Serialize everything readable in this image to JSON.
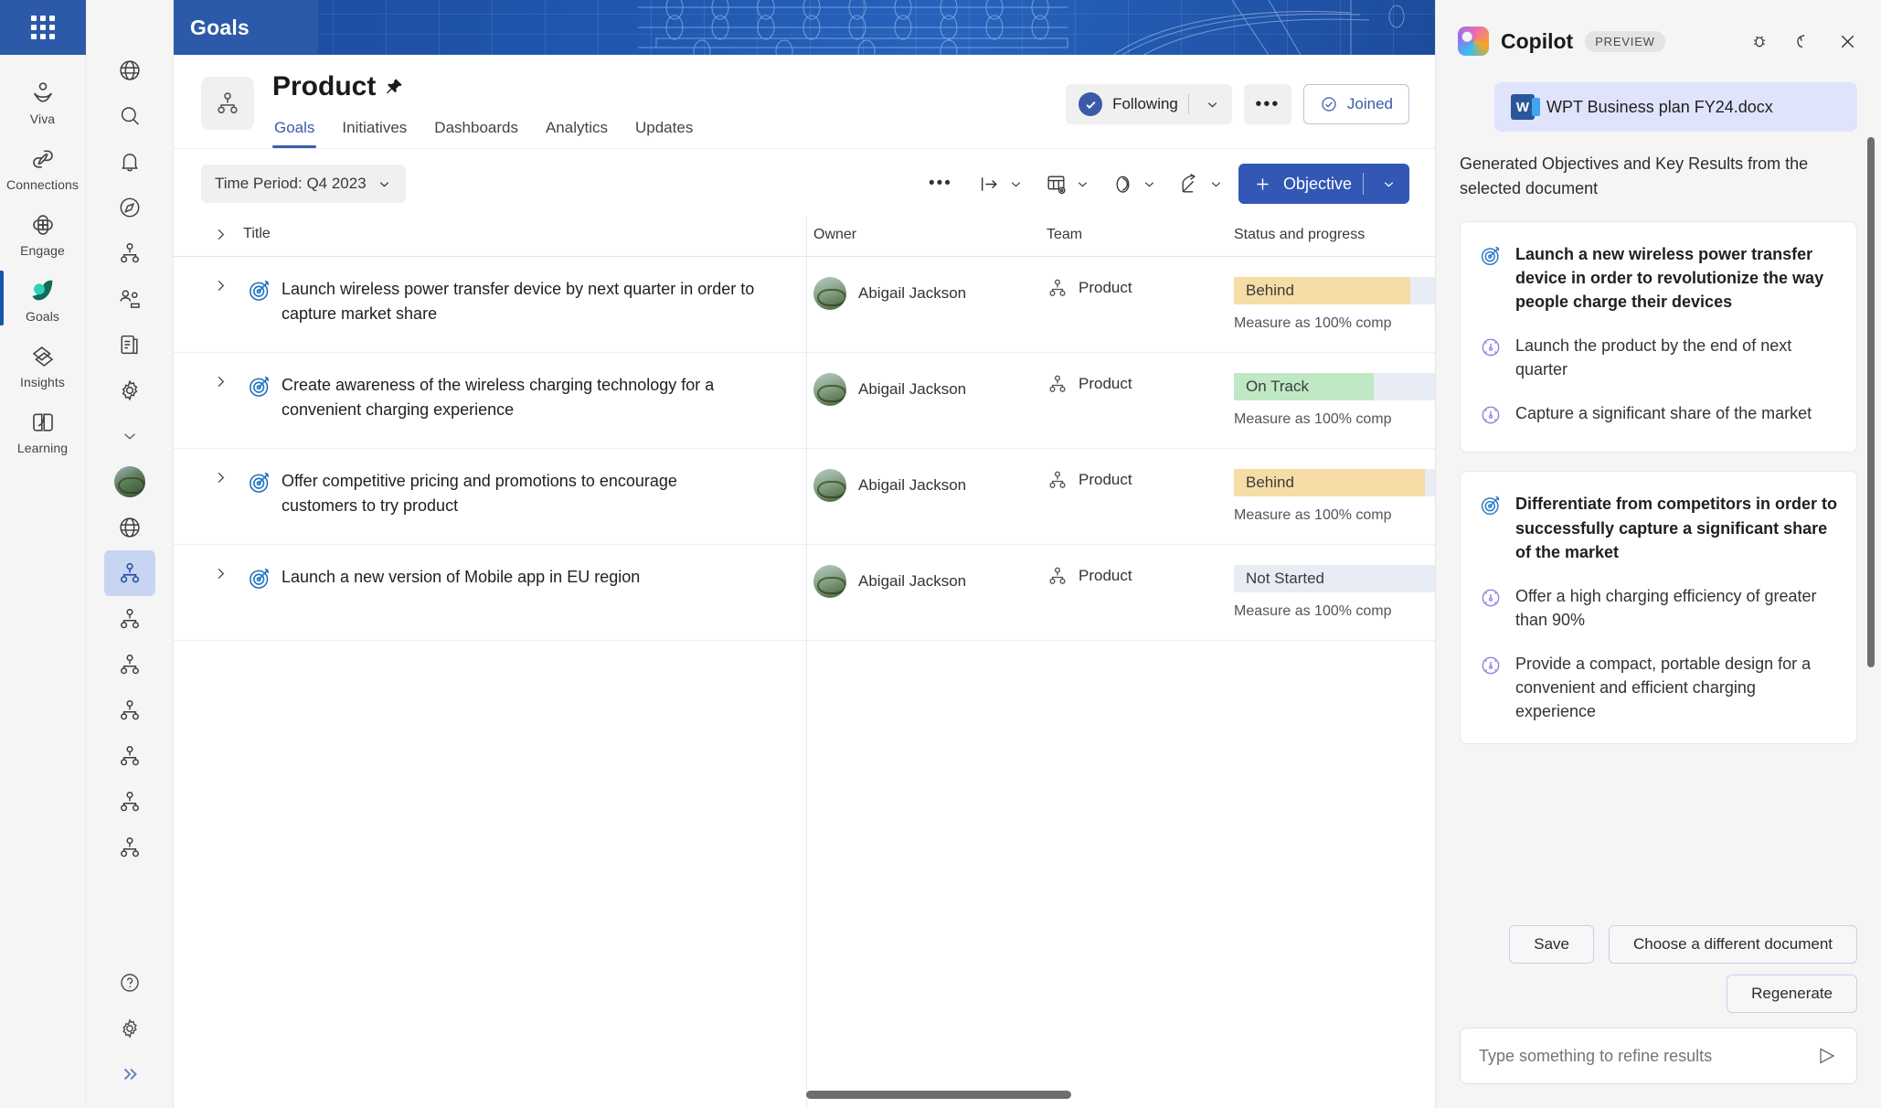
{
  "app": {
    "name": "Goals",
    "waffle_icon": "app-launcher-icon"
  },
  "app_rail": {
    "items": [
      {
        "label": "Viva",
        "icon": "viva-person-icon",
        "active": false
      },
      {
        "label": "Connections",
        "icon": "connections-link-icon",
        "active": false
      },
      {
        "label": "Engage",
        "icon": "engage-clover-icon",
        "active": false
      },
      {
        "label": "Goals",
        "icon": "goals-leaf-icon",
        "active": true
      },
      {
        "label": "Insights",
        "icon": "insights-overlap-icon",
        "active": false
      },
      {
        "label": "Learning",
        "icon": "learning-book-icon",
        "active": false
      }
    ]
  },
  "icon_rail": {
    "items": [
      {
        "icon": "globe-icon",
        "name": "home-globe",
        "selected": false
      },
      {
        "icon": "search-icon",
        "name": "search",
        "selected": false
      },
      {
        "icon": "bell-icon",
        "name": "notifications",
        "selected": false
      },
      {
        "icon": "compass-icon",
        "name": "explore",
        "selected": false
      },
      {
        "icon": "org-chart-icon",
        "name": "teams",
        "selected": false
      },
      {
        "icon": "people-icon",
        "name": "people",
        "selected": false
      },
      {
        "icon": "report-icon",
        "name": "reports",
        "selected": false
      },
      {
        "icon": "gear-icon",
        "name": "settings",
        "selected": false
      },
      {
        "icon": "chevron-down-icon",
        "name": "expand-more",
        "selected": false
      },
      {
        "icon": "user-avatar",
        "name": "profile-avatar",
        "selected": false
      },
      {
        "icon": "globe-icon",
        "name": "organization",
        "selected": false
      },
      {
        "icon": "org-chart-icon",
        "name": "team-product",
        "selected": true
      },
      {
        "icon": "org-chart-icon",
        "name": "team-2",
        "selected": false
      },
      {
        "icon": "org-chart-icon",
        "name": "team-3",
        "selected": false
      },
      {
        "icon": "org-chart-icon",
        "name": "team-4",
        "selected": false
      },
      {
        "icon": "org-chart-icon",
        "name": "team-5",
        "selected": false
      },
      {
        "icon": "org-chart-icon",
        "name": "team-6",
        "selected": false
      },
      {
        "icon": "org-chart-icon",
        "name": "team-7",
        "selected": false
      }
    ],
    "bottom": [
      {
        "icon": "help-icon",
        "name": "help"
      },
      {
        "icon": "gear-icon",
        "name": "settings"
      },
      {
        "icon": "chevrons-right-icon",
        "name": "expand-rail"
      }
    ]
  },
  "page": {
    "title": "Product",
    "pin_icon": "pin-icon",
    "team_icon": "org-chart-icon",
    "tabs": [
      {
        "label": "Goals",
        "active": true
      },
      {
        "label": "Initiatives",
        "active": false
      },
      {
        "label": "Dashboards",
        "active": false
      },
      {
        "label": "Analytics",
        "active": false
      },
      {
        "label": "Updates",
        "active": false
      }
    ],
    "following_label": "Following",
    "more_label": "•••",
    "joined_label": "Joined"
  },
  "toolbar": {
    "time_period": "Time Period: Q4 2023",
    "more_label": "•••",
    "icons": [
      {
        "name": "align-arrow-icon"
      },
      {
        "name": "table-settings-icon"
      },
      {
        "name": "filter-icon"
      },
      {
        "name": "share-icon"
      }
    ],
    "objective_label": "Objective"
  },
  "table": {
    "columns": [
      "Title",
      "Owner",
      "Team",
      "Status and progress"
    ],
    "rows": [
      {
        "title": "Launch wireless power transfer device by next quarter in order to capture market share",
        "owner": "Abigail Jackson",
        "team": "Product",
        "status": "Behind",
        "status_color": "#f5dda5",
        "progress": 72,
        "measure": "Measure as 100% comp"
      },
      {
        "title": "Create awareness of the wireless charging technology for a convenient charging experience",
        "owner": "Abigail Jackson",
        "team": "Product",
        "status": "On Track",
        "status_color": "#bfe8c4",
        "progress": 57,
        "measure": "Measure as 100% comp"
      },
      {
        "title": "Offer competitive pricing and promotions to encourage customers to try product",
        "owner": "Abigail Jackson",
        "team": "Product",
        "status": "Behind",
        "status_color": "#f5dda5",
        "progress": 78,
        "measure": "Measure as 100% comp"
      },
      {
        "title": "Launch a new version of Mobile app in EU region",
        "owner": "Abigail Jackson",
        "team": "Product",
        "status": "Not Started",
        "status_color": "#e8ecf4",
        "progress": 0,
        "measure": "Measure as 100% comp"
      }
    ]
  },
  "copilot": {
    "title": "Copilot",
    "preview_badge": "PREVIEW",
    "header_icons": [
      {
        "name": "bug-icon"
      },
      {
        "name": "undo-icon"
      },
      {
        "name": "close-icon"
      }
    ],
    "document_chip": "WPT Business plan FY24.docx",
    "intro": "Generated Objectives and Key Results from the selected document",
    "cards": [
      {
        "objective": "Launch a new wireless power transfer device in order to revolutionize the way people charge their devices",
        "key_results": [
          "Launch the product by the end of next quarter",
          "Capture a significant share of the market"
        ]
      },
      {
        "objective": "Differentiate from competitors in order to successfully capture a significant share of the market",
        "key_results": [
          "Offer a high charging efficiency of greater than 90%",
          "Provide a compact, portable design for a convenient and efficient charging experience"
        ]
      }
    ],
    "save_label": "Save",
    "choose_doc_label": "Choose a different document",
    "regenerate_label": "Regenerate",
    "input_placeholder": "Type something to refine results",
    "send_icon": "send-icon"
  },
  "colors": {
    "accent": "#3257b5",
    "banner": "#1f55ad",
    "behind": "#f5dda5",
    "on_track": "#bfe8c4",
    "not_started": "#e8ecf4"
  }
}
